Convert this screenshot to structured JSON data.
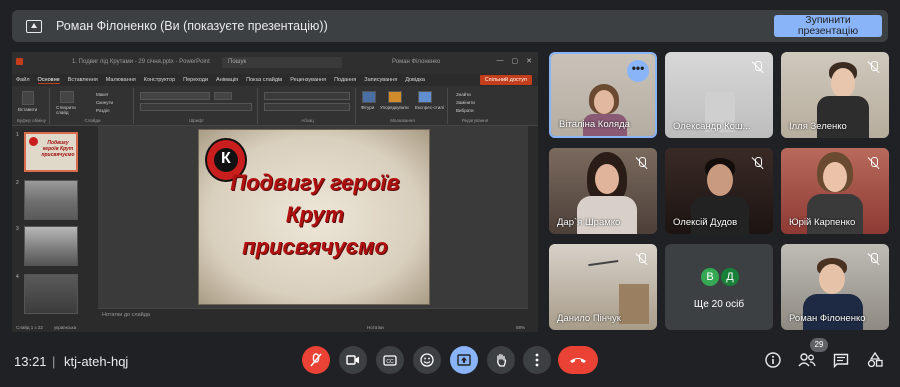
{
  "topbar": {
    "title": "Роман Філоненко (Ви (показуєте презентацію))",
    "stop_button": "Зупинити презентацію"
  },
  "powerpoint": {
    "window_title": "1. Подвиг під Крутами - 29 січня.pptx - PowerPoint",
    "search_placeholder": "Пошук",
    "user": "Роман Філоненко",
    "tabs": [
      "Файл",
      "Основне",
      "Вставлення",
      "Малювання",
      "Конструктор",
      "Переходи",
      "Анімація",
      "Показ слайдів",
      "Рецензування",
      "Подання",
      "Записування",
      "Довідка"
    ],
    "active_tab": "Основне",
    "share_button": "Спільний доступ",
    "ribbon_groups": [
      "Буфер обміну",
      "Слайди",
      "Шрифт",
      "Абзац",
      "Малювання",
      "Редагування"
    ],
    "ribbon_buttons": {
      "paste": "Вставити",
      "new_slide": "Створити слайд",
      "layout": "Макет",
      "reset": "Скинути",
      "sections": "Розділ",
      "shapes": "Фігури",
      "arrange": "Упорядкувати",
      "quick_styles": "Експрес-стилі",
      "find": "Знайти",
      "replace": "Замінити",
      "select": "Вибрати"
    },
    "slide_numbers": [
      "1",
      "2",
      "3",
      "4"
    ],
    "slide_thumb1_text": "Подвигу героїв Крут присвячуємо",
    "slide_lines": [
      "Подвигу героїв",
      "Крут",
      "присвячуємо"
    ],
    "notes_placeholder": "Нотатки до слайда",
    "status_left": "Слайд 1 з 22",
    "status_lang": "українська",
    "status_notes": "Нотатки",
    "status_zoom": "58%"
  },
  "participants": [
    {
      "name": "Віталіна Коляда",
      "muted": false,
      "active": true
    },
    {
      "name": "Олександр Кош...",
      "muted": true
    },
    {
      "name": "Ілля Зеленко",
      "muted": true
    },
    {
      "name": "Дар`я Шрамко",
      "muted": true
    },
    {
      "name": "Олексій Дудов",
      "muted": true
    },
    {
      "name": "Юрій Карпенко",
      "muted": true
    },
    {
      "name": "Данило Пінчук",
      "muted": true
    },
    {
      "name": "Роман Філоненко",
      "muted": true
    }
  ],
  "others_tile": {
    "avatars": [
      "В",
      "Д"
    ],
    "avatar_colors": [
      "#34a853",
      "#188038"
    ],
    "label": "Ще 20 осіб"
  },
  "bottom_bar": {
    "time": "13:21",
    "separator": "|",
    "meeting_code": "ktj-ateh-hqj",
    "participant_count": "29"
  },
  "colors": {
    "accent": "#8ab4f8",
    "danger": "#ea4335",
    "background": "#202124"
  }
}
